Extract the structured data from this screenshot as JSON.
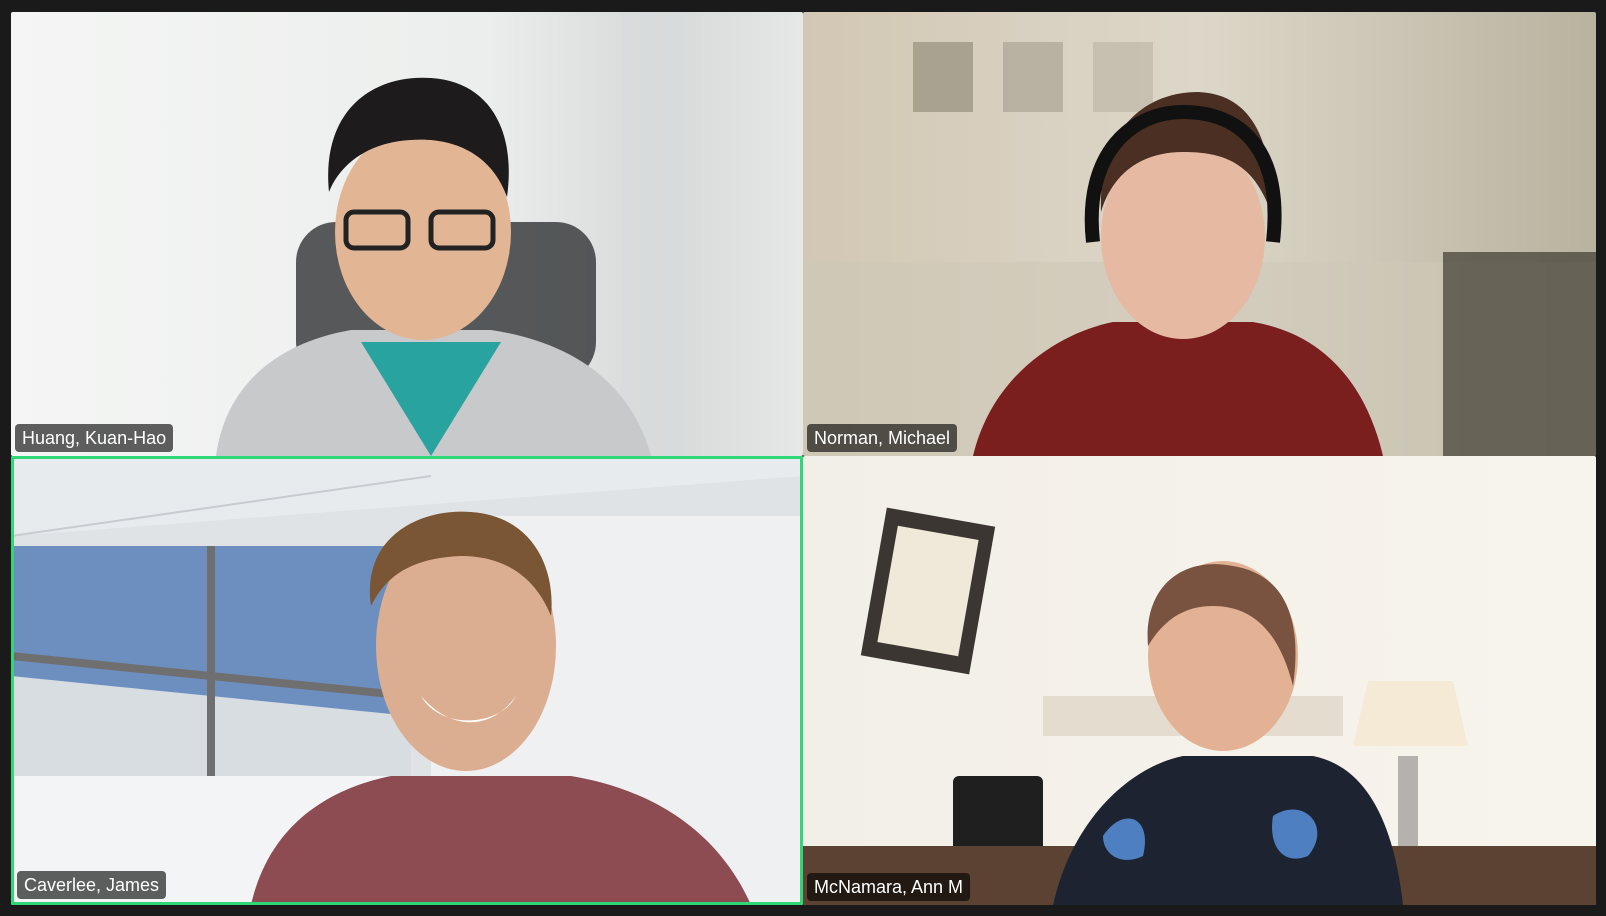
{
  "meeting": {
    "active_speaker_color": "#2fd876",
    "participants": [
      {
        "name": "Huang, Kuan-Hao"
      },
      {
        "name": "Norman, Michael"
      },
      {
        "name": "Caverlee, James",
        "active_speaker": true
      },
      {
        "name": "McNamara, Ann M"
      }
    ]
  }
}
